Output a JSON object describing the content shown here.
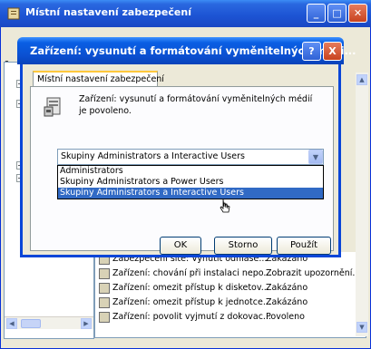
{
  "outer_window": {
    "title": "Místní nastavení zabezpečení",
    "left_marker": "&"
  },
  "background_list": {
    "rows": [
      {
        "name": "Zabezpečení sítě: Vynutit odhláše...",
        "value": "Zakázáno"
      },
      {
        "name": "Zařízení: chování při instalaci nepo...",
        "value": "Zobrazit upozornění..."
      },
      {
        "name": "Zařízení: omezit přístup k disketov...",
        "value": "Zakázáno"
      },
      {
        "name": "Zařízení: omezit přístup k jednotce...",
        "value": "Zakázáno"
      },
      {
        "name": "Zařízení: povolit vyjmutí z dokovac...",
        "value": "Povoleno"
      }
    ]
  },
  "dialog": {
    "title": "Zařízení: vysunutí a formátování vyměnitelných médi...",
    "help_label": "?",
    "close_label": "X",
    "tab_label": "Místní nastavení zabezpečení",
    "description": "Zařízení: vysunutí a formátování vyměnitelných médií je povoleno.",
    "combo_value": "Skupiny Administrators a Interactive Users",
    "options": [
      {
        "label": "Administrators",
        "selected": false
      },
      {
        "label": "Skupiny Administrators a Power Users",
        "selected": false
      },
      {
        "label": "Skupiny Administrators a Interactive Users",
        "selected": true
      }
    ],
    "buttons": {
      "ok": "OK",
      "cancel": "Storno",
      "apply": "Použít"
    }
  },
  "colors": {
    "title_blue": "#0a5fe4",
    "selection": "#316ac5",
    "desktop": "#6b2a1c",
    "close_red": "#c8431f"
  },
  "icons": [
    "window-app-icon",
    "minimize-icon",
    "maximize-icon",
    "close-icon",
    "help-icon",
    "policy-icon",
    "chevron-down-icon",
    "policy-row-icon",
    "mouse-cursor-icon"
  ]
}
